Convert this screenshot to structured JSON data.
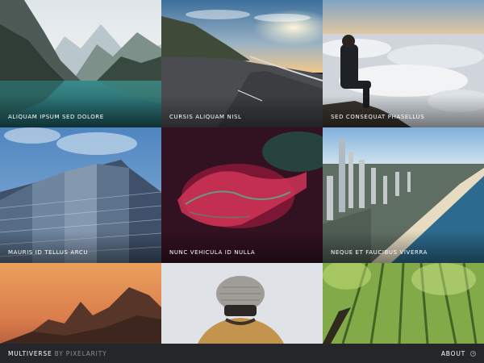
{
  "gallery": {
    "tiles": [
      {
        "caption": "ALIQUAM IPSUM SED DOLORE",
        "image": "mountain-lake"
      },
      {
        "caption": "CURSIS ALIQUAM NISL",
        "image": "road-sunset"
      },
      {
        "caption": "SED CONSEQUAT PHASELLUS",
        "image": "man-above-clouds"
      },
      {
        "caption": "MAURIS ID TELLUS ARCU",
        "image": "skyscraper"
      },
      {
        "caption": "NUNC VEHICULA ID NULLA",
        "image": "hands-neon"
      },
      {
        "caption": "NEQUE ET FAUCIBUS VIVERRA",
        "image": "coastal-city"
      },
      {
        "caption": "",
        "image": "mountain-dusk"
      },
      {
        "caption": "",
        "image": "person-beanie"
      },
      {
        "caption": "",
        "image": "bamboo-forest"
      }
    ]
  },
  "footer": {
    "brand_name": "MULTIVERSE",
    "brand_suffix": "BY PIXELARITY",
    "about_label": "ABOUT",
    "about_icon": "info-circle-icon"
  }
}
